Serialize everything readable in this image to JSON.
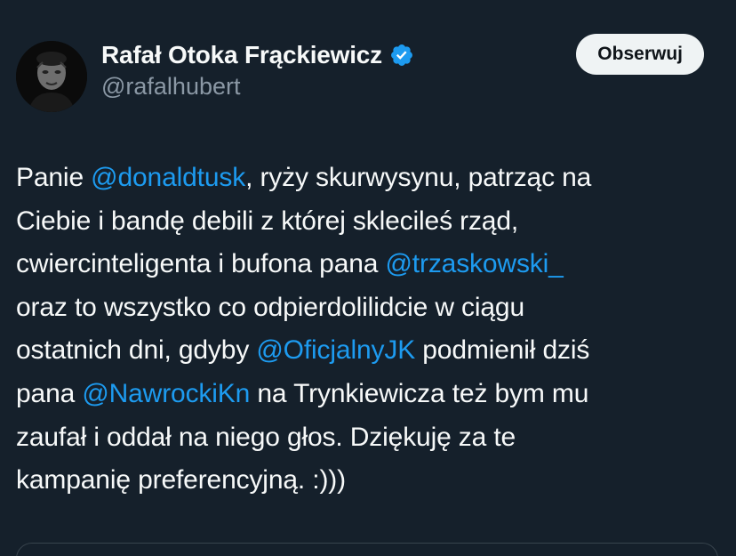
{
  "author": {
    "display_name": "Rafał Otoka Frąckiewicz",
    "handle": "@rafalhubert",
    "avatar_icon": "profile-photo-avatar",
    "verified_icon": "verified-badge-icon",
    "verified_color": "#1d9bf0"
  },
  "follow_button": {
    "label": "Obserwuj"
  },
  "tweet": {
    "line1": {
      "t1": "Panie ",
      "m1": "@donaldtusk",
      "t2": ", ryży skurwysynu, patrząc na"
    },
    "line2": {
      "t1": "Ciebie i bandę debili z której sklecileś rząd,"
    },
    "line3": {
      "t1": "cwiercinteligenta i bufona pana ",
      "m1": "@trzaskowski_"
    },
    "line4": {
      "t1": "oraz to wszystko co odpierdolilidcie w ciągu"
    },
    "line5": {
      "t1": "ostatnich dni, gdyby ",
      "m1": "@OficjalnyJK",
      "t2": " podmienił dziś"
    },
    "line6": {
      "t1": "pana ",
      "m1": "@NawrockiKn",
      "t2": " na Trynkiewicza też bym mu"
    },
    "line7": {
      "t1": "zaufał i oddał na niego głos. Dziękuję za te"
    },
    "line8": {
      "t1": "kampanię preferencyjną. :)))"
    }
  },
  "colors": {
    "background": "#15202b",
    "text": "#f7f9f9",
    "secondary_text": "#8b98a5",
    "link": "#1d9bf0",
    "button_bg": "#eff3f4"
  }
}
